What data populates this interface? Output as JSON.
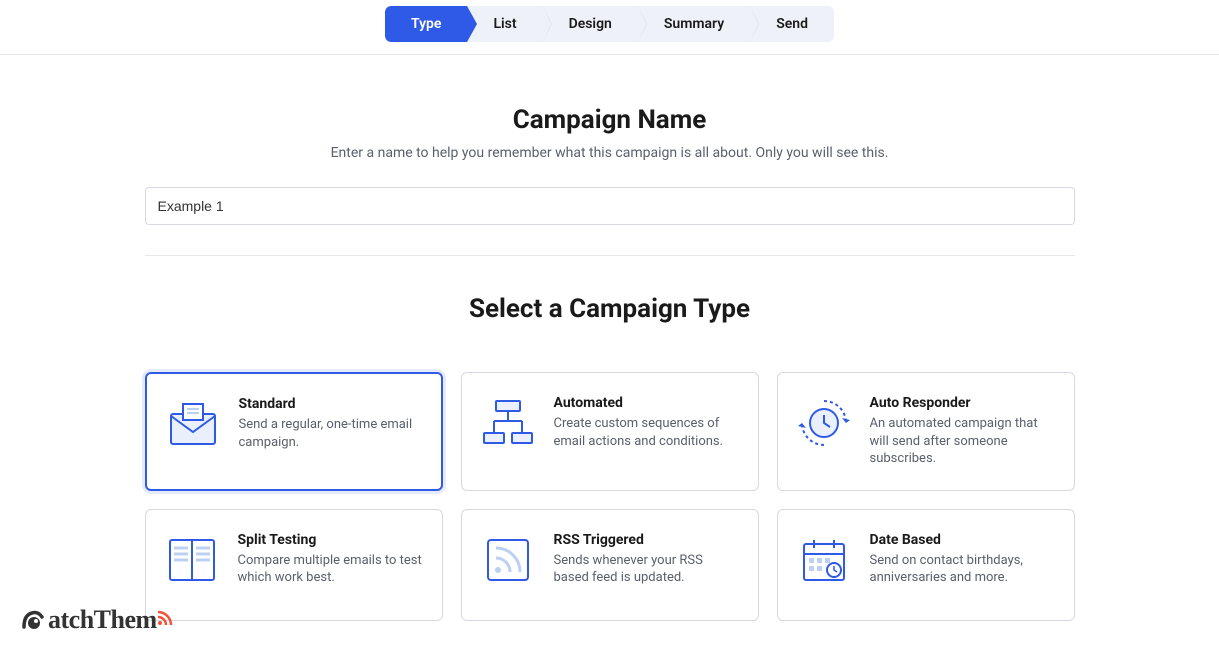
{
  "stepper": {
    "steps": [
      {
        "label": "Type",
        "active": true
      },
      {
        "label": "List",
        "active": false
      },
      {
        "label": "Design",
        "active": false
      },
      {
        "label": "Summary",
        "active": false
      },
      {
        "label": "Send",
        "active": false
      }
    ]
  },
  "campaign_name": {
    "heading": "Campaign Name",
    "subtitle": "Enter a name to help you remember what this campaign is all about. Only you will see this.",
    "value": "Example 1"
  },
  "select_type": {
    "heading": "Select a Campaign Type",
    "cards": [
      {
        "id": "standard",
        "title": "Standard",
        "desc": "Send a regular, one-time email campaign.",
        "selected": true,
        "icon": "envelope-icon"
      },
      {
        "id": "automated",
        "title": "Automated",
        "desc": "Create custom sequences of email actions and conditions.",
        "selected": false,
        "icon": "workflow-icon"
      },
      {
        "id": "autoresponder",
        "title": "Auto Responder",
        "desc": "An automated campaign that will send after someone subscribes.",
        "selected": false,
        "icon": "clock-cycle-icon"
      },
      {
        "id": "split",
        "title": "Split Testing",
        "desc": "Compare multiple emails to test which work best.",
        "selected": false,
        "icon": "ab-test-icon"
      },
      {
        "id": "rss",
        "title": "RSS Triggered",
        "desc": "Sends whenever your RSS based feed is updated.",
        "selected": false,
        "icon": "rss-icon"
      },
      {
        "id": "date",
        "title": "Date Based",
        "desc": "Send on contact birthdays, anniversaries and more.",
        "selected": false,
        "icon": "calendar-icon"
      }
    ]
  },
  "watermark": {
    "text": "atchThem"
  },
  "colors": {
    "primary": "#2f5ae8",
    "border": "#d6d9e0",
    "text_muted": "#5a5f6b"
  }
}
